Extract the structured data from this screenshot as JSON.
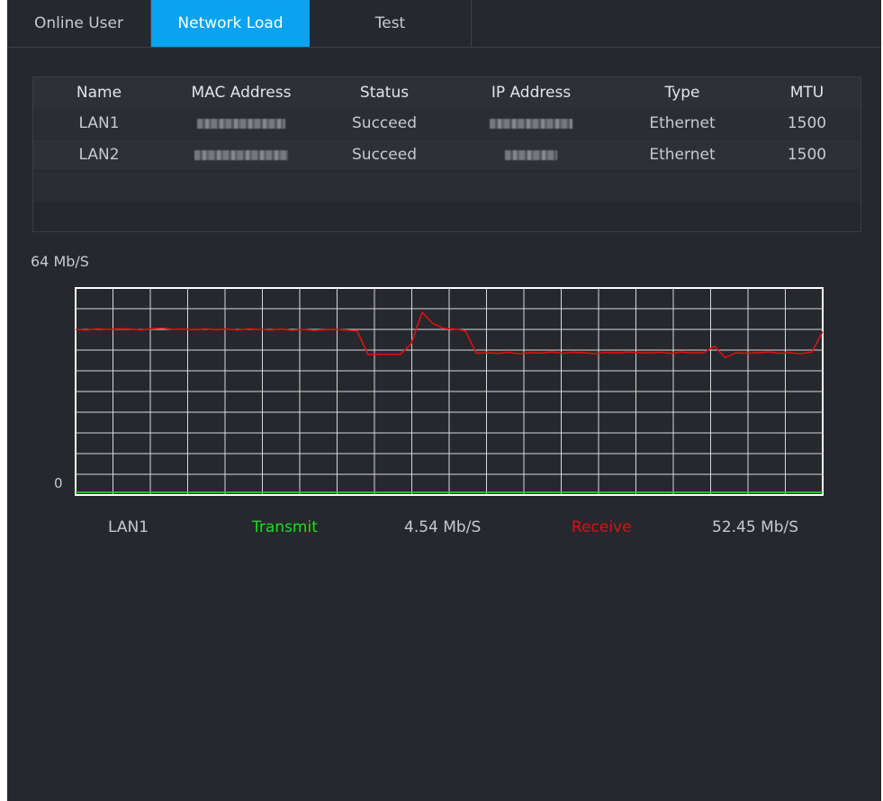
{
  "tabs": [
    {
      "label": "Online User",
      "active": false
    },
    {
      "label": "Network Load",
      "active": true
    },
    {
      "label": "Test",
      "active": false
    }
  ],
  "table": {
    "headers": [
      "Name",
      "MAC Address",
      "Status",
      "IP Address",
      "Type",
      "MTU"
    ],
    "rows": [
      {
        "name": "LAN1",
        "mac": "",
        "status": "Succeed",
        "ip": "",
        "type": "Ethernet",
        "mtu": "1500"
      },
      {
        "name": "LAN2",
        "mac": "",
        "status": "Succeed",
        "ip": "",
        "type": "Ethernet",
        "mtu": "1500"
      }
    ]
  },
  "colors": {
    "accent": "#09a3f2",
    "transmit": "#18e01a",
    "receive": "#e01010",
    "grid": "#ffffff"
  },
  "chart_data": {
    "type": "line",
    "ylabel": "64 Mb/S",
    "ymin_label": "0",
    "ylim": [
      0,
      64
    ],
    "grid": true,
    "series": [
      {
        "name": "Receive",
        "color": "#e01010",
        "values": [
          51.2,
          51.0,
          51.4,
          51.2,
          51.4,
          51.3,
          51.0,
          51.4,
          51.6,
          51.2,
          51.3,
          51.1,
          51.4,
          51.1,
          51.3,
          51.0,
          51.4,
          51.2,
          51.0,
          51.3,
          50.9,
          51.2,
          50.9,
          51.1,
          51.2,
          51.0,
          50.7,
          43.5,
          43.5,
          43.5,
          43.5,
          46.8,
          56.5,
          53.0,
          51.5,
          51.3,
          50.8,
          43.8,
          44.0,
          43.8,
          44.1,
          43.7,
          44.0,
          43.9,
          44.2,
          43.8,
          44.1,
          44.0,
          43.7,
          44.1,
          43.9,
          44.2,
          44.0,
          43.9,
          44.1,
          43.8,
          44.2,
          43.9,
          44.0,
          46.0,
          42.5,
          44.0,
          43.8,
          44.0,
          44.2,
          43.8,
          44.0,
          43.7,
          44.2,
          50.5
        ]
      },
      {
        "name": "Transmit",
        "color": "#18e01a",
        "values": [
          0.8,
          0.8,
          0.8,
          0.8,
          0.8,
          0.8,
          0.8,
          0.8,
          0.8,
          0.8,
          0.8,
          0.8,
          0.8,
          0.8,
          0.8,
          0.8,
          0.8,
          0.8,
          0.8,
          0.8,
          0.8,
          0.8,
          0.8,
          0.8,
          0.8,
          0.8,
          0.8,
          0.8,
          0.8,
          0.8,
          0.8,
          0.8,
          0.8,
          0.8,
          0.8,
          0.8,
          0.8,
          0.8,
          0.8,
          0.8,
          0.8,
          0.8,
          0.8,
          0.8,
          0.8,
          0.8,
          0.8,
          0.8,
          0.8,
          0.8,
          0.8,
          0.8,
          0.8,
          0.8,
          0.8,
          0.8,
          0.8,
          0.8,
          0.8,
          0.8,
          0.8,
          0.8,
          0.8,
          0.8,
          0.8,
          0.8,
          0.8,
          0.8,
          0.8,
          0.8
        ]
      }
    ]
  },
  "legend": {
    "interface": "LAN1",
    "transmit_label": "Transmit",
    "transmit_value": "4.54 Mb/S",
    "receive_label": "Receive",
    "receive_value": "52.45 Mb/S"
  }
}
